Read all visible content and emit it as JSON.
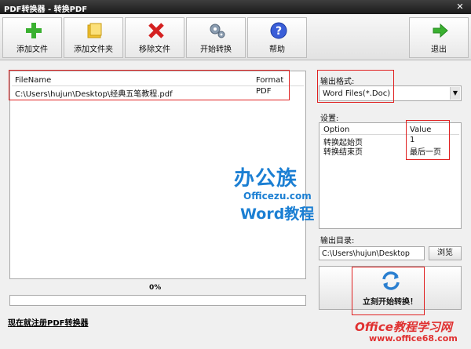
{
  "window": {
    "title": "PDF转换器 - 转换PDF",
    "close_glyph": "✕"
  },
  "toolbar": {
    "add_file": "添加文件",
    "add_folder": "添加文件夹",
    "remove_file": "移除文件",
    "start_convert": "开始转换",
    "help": "帮助",
    "exit": "退出"
  },
  "file_list": {
    "headers": {
      "filename": "FileName",
      "format": "Format"
    },
    "rows": [
      {
        "filename": "C:\\Users\\hujun\\Desktop\\经典五笔教程.pdf",
        "format": "PDF"
      }
    ]
  },
  "progress": {
    "label": "0%",
    "value": 0
  },
  "register_link": "现在就注册PDF转换器",
  "output_format": {
    "label": "输出格式:",
    "selected": "Word Files(*.Doc)"
  },
  "settings": {
    "label": "设置:",
    "headers": {
      "option": "Option",
      "value": "Value"
    },
    "rows": [
      {
        "option": "转换起始页",
        "value": "1"
      },
      {
        "option": "转换结束页",
        "value": "最后一页"
      }
    ]
  },
  "output_dir": {
    "label": "输出目录:",
    "value": "C:\\Users\\hujun\\Desktop",
    "browse": "浏览"
  },
  "start_button": {
    "label": "立刻开始转换！"
  },
  "watermark": {
    "brand": "办公族",
    "domain": "Officezu.com",
    "tutorial": "Word教程",
    "site_name": "Office教程学习网",
    "site_url": "www.office68.com"
  },
  "colors": {
    "accent": "#1b7fd3",
    "highlight": "#e02020",
    "progress": "#3a78d8"
  }
}
